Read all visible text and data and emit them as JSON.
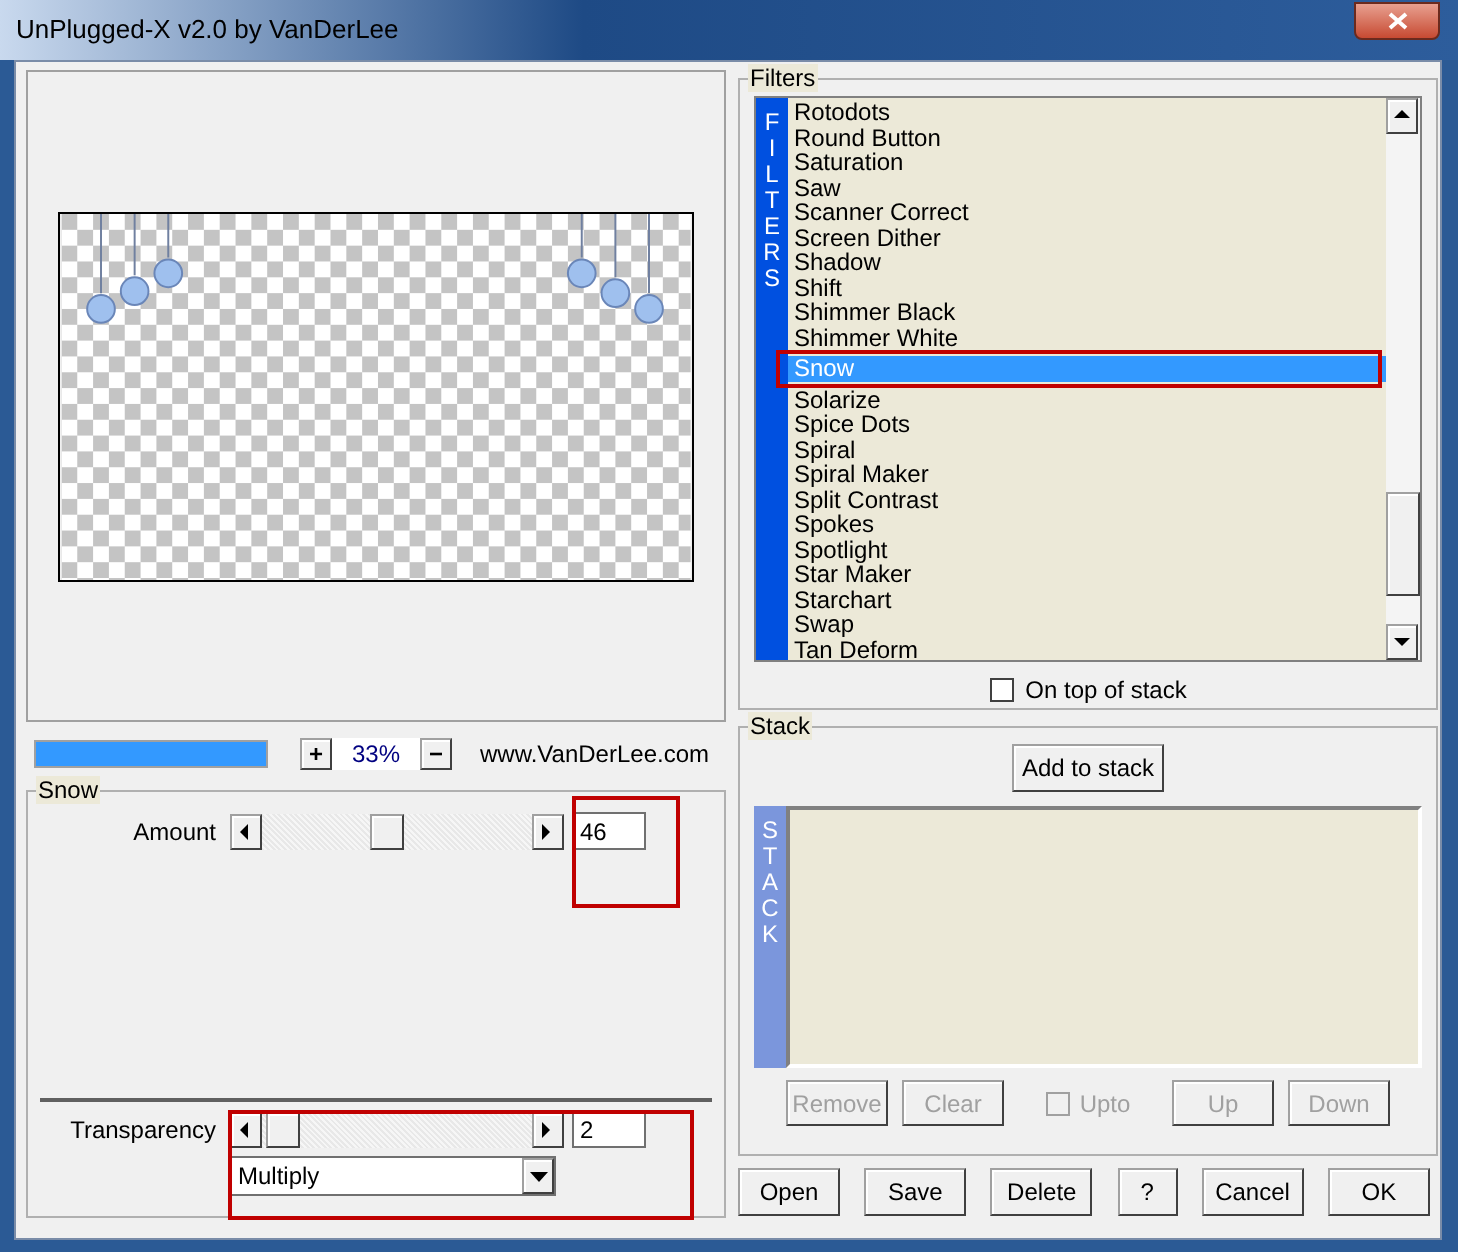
{
  "window": {
    "title": "UnPlugged-X v2.0 by VanDerLee"
  },
  "zoom": {
    "progress": {
      "level": 1
    },
    "plus": "+",
    "value": "33%",
    "minus": "−",
    "website": "www.VanDerLee.com"
  },
  "settings": {
    "title": "Snow",
    "sliders": [
      {
        "label": "Amount",
        "level": 0.46,
        "value": "46"
      }
    ],
    "transparency": {
      "label": "Transparency",
      "level": 0.02,
      "value": "2",
      "blend_mode": "Multiply"
    }
  },
  "filters": {
    "title": "Filters",
    "side_label": "FILTERS",
    "items": [
      {
        "label": "Rotodots",
        "selected": false
      },
      {
        "label": "Round Button",
        "selected": false
      },
      {
        "label": "Saturation",
        "selected": false
      },
      {
        "label": "Saw",
        "selected": false
      },
      {
        "label": "Scanner Correct",
        "selected": false
      },
      {
        "label": "Screen Dither",
        "selected": false
      },
      {
        "label": "Shadow",
        "selected": false
      },
      {
        "label": "Shift",
        "selected": false
      },
      {
        "label": "Shimmer Black",
        "selected": false
      },
      {
        "label": "Shimmer White",
        "selected": false
      },
      {
        "label": "Snow",
        "selected": true
      },
      {
        "label": "Solarize",
        "selected": false
      },
      {
        "label": "Spice Dots",
        "selected": false
      },
      {
        "label": "Spiral",
        "selected": false
      },
      {
        "label": "Spiral Maker",
        "selected": false
      },
      {
        "label": "Split Contrast",
        "selected": false
      },
      {
        "label": "Spokes",
        "selected": false
      },
      {
        "label": "Spotlight",
        "selected": false
      },
      {
        "label": "Star Maker",
        "selected": false
      },
      {
        "label": "Starchart",
        "selected": false
      },
      {
        "label": "Swap",
        "selected": false
      },
      {
        "label": "Tan Deform",
        "selected": false
      }
    ],
    "on_top": {
      "label": "On top of stack",
      "checked": false
    }
  },
  "stack": {
    "title": "Stack",
    "side_label": "STACK",
    "add_button": "Add to stack",
    "controls": [
      {
        "kind": "button",
        "label": "Remove",
        "disabled": true
      },
      {
        "kind": "button",
        "label": "Clear",
        "disabled": true
      },
      {
        "kind": "checkbox",
        "label": "Upto",
        "checked": false,
        "disabled": true
      },
      {
        "kind": "button",
        "label": "Up",
        "disabled": true
      },
      {
        "kind": "button",
        "label": "Down",
        "disabled": true
      }
    ]
  },
  "buttons": [
    "Open",
    "Save",
    "Delete",
    "?",
    "Cancel",
    "OK"
  ]
}
